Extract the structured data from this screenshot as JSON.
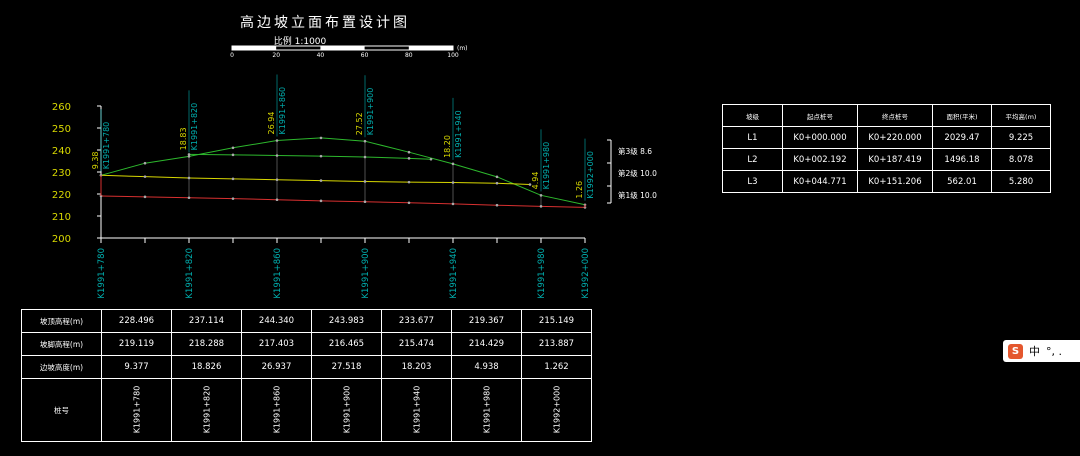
{
  "title": "高边坡立面布置设计图",
  "scale": {
    "label": "比例 1:1000",
    "ticks": [
      "0",
      "20",
      "40",
      "60",
      "80",
      "100"
    ],
    "unit": "(m)"
  },
  "colors": {
    "axis_label": "#d8d800",
    "stake_label": "#00b0b0",
    "crest_line": "#2db82d",
    "slope_line": "#d8d800",
    "toe_line": "#d83030",
    "grid": "#888888"
  },
  "chart_data": {
    "type": "line",
    "title": "高边坡立面布置设计图",
    "xlabel": "",
    "ylabel": "",
    "ylim": [
      200,
      260
    ],
    "yticks": [
      200,
      210,
      220,
      230,
      240,
      250,
      260
    ],
    "stakes": [
      "K1991+780",
      "K1991+820",
      "K1991+860",
      "K1991+900",
      "K1991+940",
      "K1991+980",
      "K1992+000"
    ],
    "stake_positions": [
      780,
      820,
      860,
      900,
      940,
      980,
      1000
    ],
    "height_labels": [
      "9.38",
      "18.83",
      "26.94",
      "27.52",
      "18.20",
      "4.94",
      "1.26"
    ],
    "top_elevations": [
      228.496,
      237.114,
      244.34,
      243.983,
      233.677,
      219.367,
      215.149
    ],
    "toe_elevations": [
      219.119,
      218.288,
      217.403,
      216.465,
      215.474,
      214.429,
      213.887
    ],
    "series": [
      {
        "x": [
          780,
          800,
          820,
          840,
          860,
          880,
          900,
          920,
          940,
          960,
          980,
          1000
        ],
        "values": [
          228.5,
          234,
          237.1,
          241,
          244.3,
          245.5,
          244,
          239,
          233.7,
          227.8,
          219.4,
          215.1
        ]
      },
      {
        "x": [
          820,
          840,
          860,
          880,
          900,
          920,
          930
        ],
        "values": [
          238,
          237.8,
          237.5,
          237.2,
          236.8,
          236.2,
          235.8
        ]
      },
      {
        "x": [
          780,
          800,
          820,
          840,
          860,
          880,
          900,
          920,
          940,
          960,
          975
        ],
        "values": [
          228.5,
          227.9,
          227.3,
          226.9,
          226.5,
          226.1,
          225.7,
          225.4,
          225.2,
          224.9,
          224.3
        ]
      },
      {
        "x": [
          780,
          800,
          820,
          840,
          860,
          880,
          900,
          920,
          940,
          960,
          980,
          1000
        ],
        "values": [
          219.1,
          218.7,
          218.3,
          217.9,
          217.4,
          216.9,
          216.5,
          216.0,
          215.5,
          214.9,
          214.4,
          213.9
        ]
      }
    ],
    "levels": [
      {
        "label": "第3级 8.6"
      },
      {
        "label": "第2级 10.0"
      },
      {
        "label": "第1级 10.0"
      }
    ]
  },
  "bottom_table": {
    "rows": [
      {
        "header": "坡顶高程(m)",
        "values": [
          "228.496",
          "237.114",
          "244.340",
          "243.983",
          "233.677",
          "219.367",
          "215.149"
        ]
      },
      {
        "header": "坡脚高程(m)",
        "values": [
          "219.119",
          "218.288",
          "217.403",
          "216.465",
          "215.474",
          "214.429",
          "213.887"
        ]
      },
      {
        "header": "边坡高度(m)",
        "values": [
          "9.377",
          "18.826",
          "26.937",
          "27.518",
          "18.203",
          "4.938",
          "1.262"
        ]
      }
    ],
    "stake_header": "桩号",
    "stakes": [
      "K1991+780",
      "K1991+820",
      "K1991+860",
      "K1991+900",
      "K1991+940",
      "K1991+980",
      "K1992+000"
    ]
  },
  "right_table": {
    "headers": [
      "坡级",
      "起点桩号",
      "终点桩号",
      "面积(平米)",
      "平均高(m)"
    ],
    "rows": [
      [
        "L1",
        "K0+000.000",
        "K0+220.000",
        "2029.47",
        "9.225"
      ],
      [
        "L2",
        "K0+002.192",
        "K0+187.419",
        "1496.18",
        "8.078"
      ],
      [
        "L3",
        "K0+044.771",
        "K0+151.206",
        "562.01",
        "5.280"
      ]
    ]
  },
  "ime": {
    "logo": "S",
    "text": "中",
    "dots": "°, ."
  }
}
